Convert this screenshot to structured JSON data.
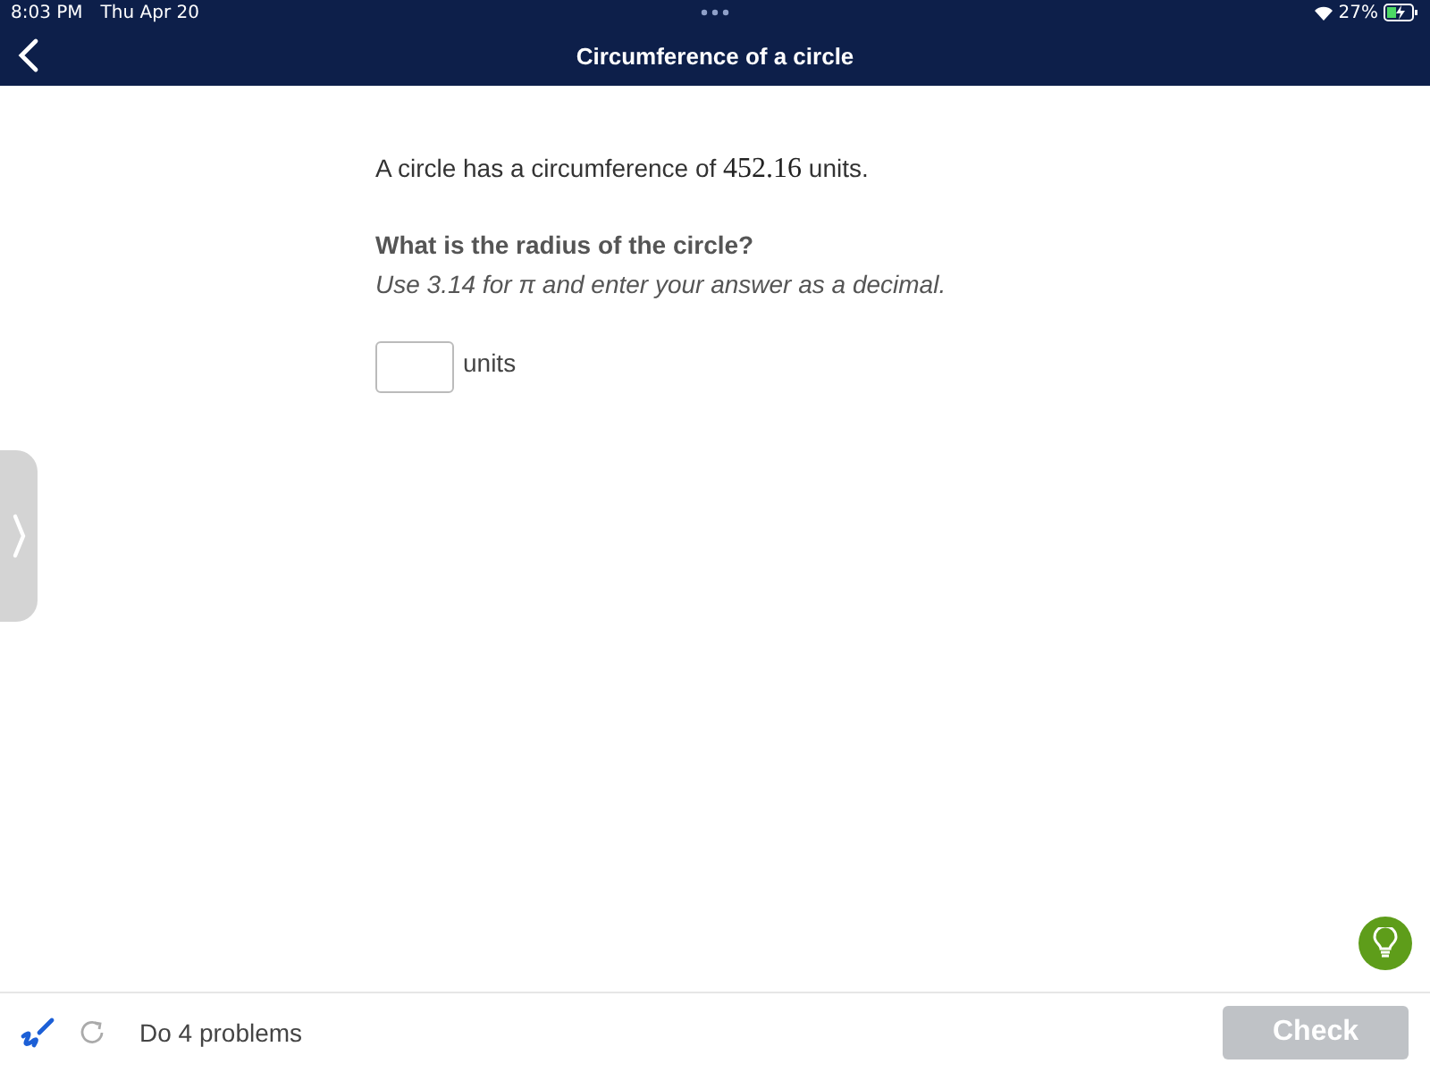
{
  "status_bar": {
    "time": "8:03 PM",
    "date": "Thu Apr 20",
    "battery": "27%"
  },
  "nav": {
    "title": "Circumference of a circle"
  },
  "problem": {
    "statement": {
      "before": "A circle has a circumference of ",
      "number": "452.16",
      "after": " units."
    },
    "question": "What is the radius of the circle?",
    "hint": "Use 3.14 for π and enter your answer as a decimal.",
    "answer": {
      "unit": "units"
    }
  },
  "footer": {
    "progress": "Do 4 problems",
    "check_button": {
      "label": "Check",
      "disabled": true
    }
  }
}
